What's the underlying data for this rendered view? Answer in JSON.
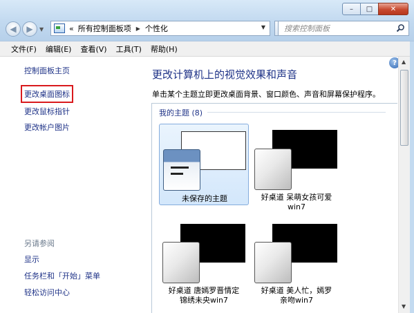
{
  "window": {
    "controls": {
      "minimize": "–",
      "maximize": "□",
      "close": "✕"
    }
  },
  "nav": {
    "back_glyph": "◀",
    "forward_glyph": "▶",
    "dropdown_glyph": "▼"
  },
  "address": {
    "overflow": "«",
    "crumbs": [
      "所有控制面板项",
      "个性化"
    ],
    "separator": "▶",
    "dropdown": "▼"
  },
  "search": {
    "placeholder": "搜索控制面板"
  },
  "menu": [
    "文件(F)",
    "编辑(E)",
    "查看(V)",
    "工具(T)",
    "帮助(H)"
  ],
  "sidebar": {
    "links": [
      "控制面板主页",
      "更改桌面图标",
      "更改鼠标指针",
      "更改帐户图片"
    ],
    "see_also_heading": "另请参阅",
    "see_also": [
      "显示",
      "任务栏和「开始」菜单",
      "轻松访问中心"
    ]
  },
  "main": {
    "help": "?",
    "title": "更改计算机上的视觉效果和声音",
    "description": "单击某个主题立即更改桌面背景、窗口颜色、声音和屏幕保护程序。",
    "group": "我的主题 (8)",
    "themes": [
      {
        "line1": "未保存的主题",
        "line2": ""
      },
      {
        "line1": "好桌道 呆萌女孩可爱",
        "line2": "win7"
      },
      {
        "line1": "好桌道 唐嫣罗晋情定",
        "line2": "锦绣未央win7"
      },
      {
        "line1": "好桌道 美人忙，嫣罗",
        "line2": "亲吻win7"
      }
    ]
  },
  "scrollbar": {
    "up": "▲",
    "down": "▼"
  },
  "colors": {
    "link": "#1e3287",
    "highlight_box": "#d9191c",
    "selection": "#d3e7fb"
  }
}
